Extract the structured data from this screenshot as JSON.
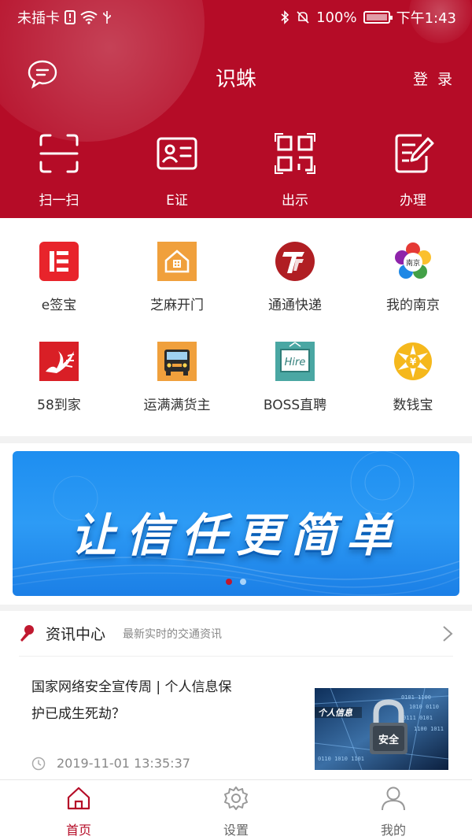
{
  "status_bar": {
    "carrier": "未插卡",
    "battery": "100%",
    "battery_level": 1.0,
    "time": "下午1:43"
  },
  "header": {
    "title": "识蛛",
    "login": "登 录",
    "brand_color": "#b50c27"
  },
  "quick_actions": [
    {
      "label": "扫一扫",
      "icon": "scan-icon"
    },
    {
      "label": "E证",
      "icon": "id-card-icon"
    },
    {
      "label": "出示",
      "icon": "qr-code-icon"
    },
    {
      "label": "办理",
      "icon": "edit-doc-icon"
    }
  ],
  "apps": [
    {
      "label": "e签宝",
      "icon": "esign-icon",
      "color": "#e8242b"
    },
    {
      "label": "芝麻开门",
      "icon": "house-icon",
      "color": "#f0a03c"
    },
    {
      "label": "通通快递",
      "icon": "tt-express-icon",
      "color": "#b01e23"
    },
    {
      "label": "我的南京",
      "icon": "flower-icon",
      "color": "#4caf50"
    },
    {
      "label": "58到家",
      "icon": "swan-icon",
      "color": "#d91f26"
    },
    {
      "label": "运满满货主",
      "icon": "truck-icon",
      "color": "#f0a03c"
    },
    {
      "label": "BOSS直聘",
      "icon": "hire-icon",
      "color": "#4aa7a3"
    },
    {
      "label": "数钱宝",
      "icon": "yuan-coin-icon",
      "color": "#f5b81c"
    }
  ],
  "banner": {
    "text": "让信任更简单",
    "slides": 2,
    "active_slide": 1
  },
  "news": {
    "title": "资讯中心",
    "subtitle": "最新实时的交通资讯",
    "item": {
      "headline": "国家网络安全宣传周 | 个人信息保护已成生死劫？",
      "time": "2019-11-01 13:35:37",
      "thumb_text_1": "个人信息",
      "thumb_text_2": "安全"
    }
  },
  "tabs": [
    {
      "label": "首页",
      "icon": "home-icon",
      "active": true
    },
    {
      "label": "设置",
      "icon": "gear-icon",
      "active": false
    },
    {
      "label": "我的",
      "icon": "user-icon",
      "active": false
    }
  ]
}
